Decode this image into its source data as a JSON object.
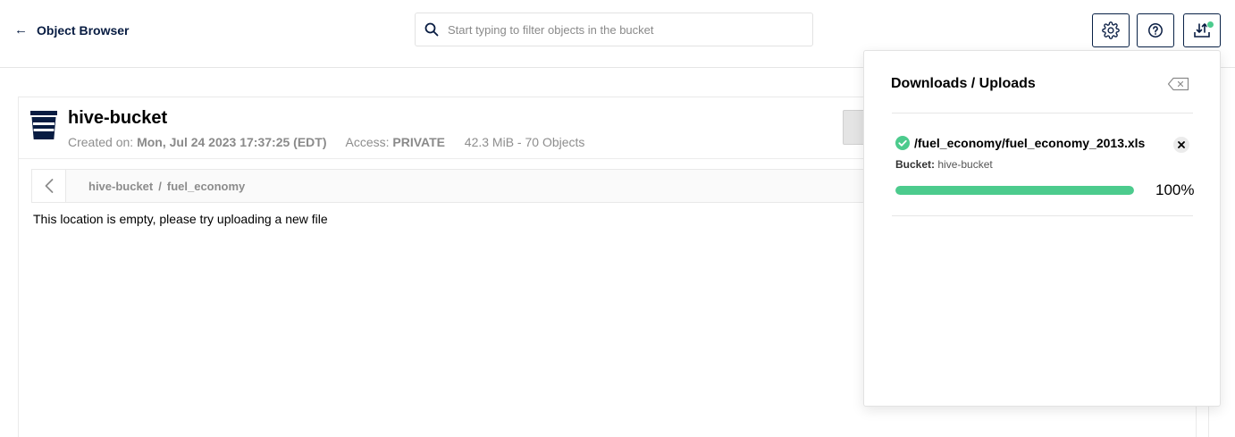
{
  "header": {
    "back_label": "Object Browser",
    "search_placeholder": "Start typing to filter objects in the bucket"
  },
  "bucket": {
    "name": "hive-bucket",
    "created_label": "Created on:",
    "created_value": "Mon, Jul 24 2023 17:37:25 (EDT)",
    "access_label": "Access:",
    "access_value": "PRIVATE",
    "stats": "42.3 MiB - 70 Objects"
  },
  "breadcrumb": {
    "items": [
      "hive-bucket",
      "fuel_economy"
    ],
    "separator": "/"
  },
  "empty_message": "This location is empty, please try uploading a new file",
  "downloads_panel": {
    "title": "Downloads / Uploads",
    "items": [
      {
        "path": "/fuel_economy/fuel_economy_2013.xls",
        "bucket_label": "Bucket:",
        "bucket_value": "hive-bucket",
        "progress": 1.0,
        "progress_text": "100%",
        "status": "complete"
      }
    ]
  },
  "colors": {
    "navy": "#081c42",
    "success": "#4ccb8d",
    "muted": "#8e8e8e"
  },
  "icons": [
    "back-arrow-icon",
    "search-icon",
    "gear-icon",
    "help-icon",
    "download-upload-icon",
    "bucket-icon",
    "chevron-left-icon",
    "clear-all-icon",
    "check-circle-icon",
    "close-icon"
  ]
}
